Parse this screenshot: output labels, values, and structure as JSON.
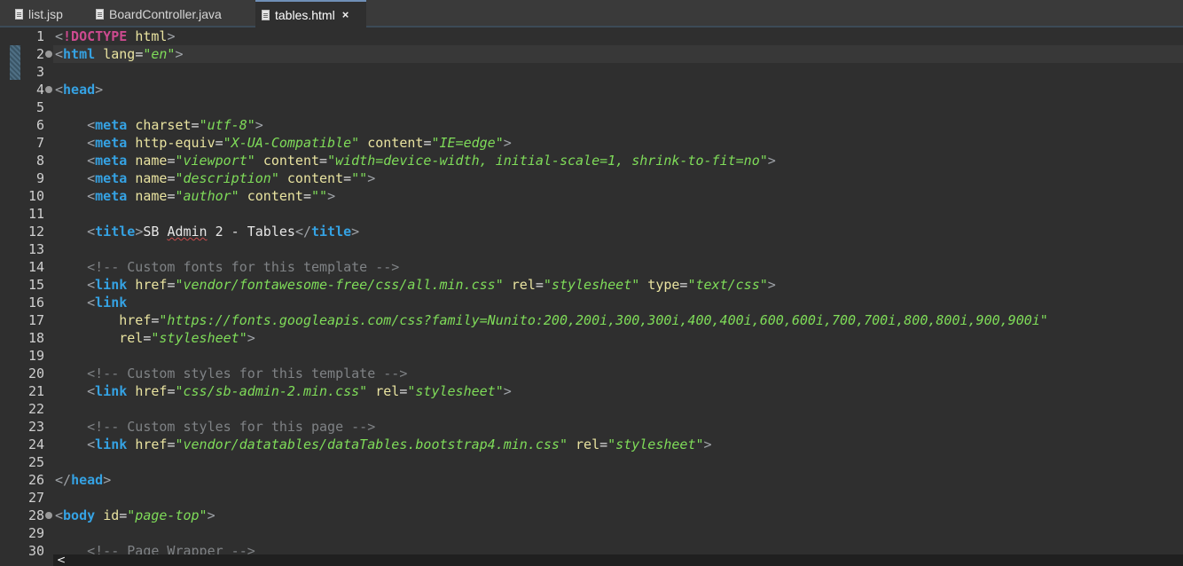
{
  "tabs": [
    {
      "label": "list.jsp",
      "icon": "file-icon",
      "active": false
    },
    {
      "label": "BoardController.java",
      "icon": "file-icon",
      "active": false
    },
    {
      "label": "tables.html",
      "icon": "file-icon",
      "active": true,
      "close": "×"
    }
  ],
  "colors": {
    "tag": "#35a2e3",
    "attribute": "#e9e3a0",
    "string": "#7fdc59",
    "comment": "#7f8285",
    "doctype": "#cc4a8f",
    "background": "#2f2f2f"
  },
  "editor": {
    "lines": [
      {
        "n": "1",
        "fold": false,
        "tokens": [
          [
            "bracket",
            "<"
          ],
          [
            "doctype",
            "!DOCTYPE "
          ],
          [
            "attr",
            "html"
          ],
          [
            "bracket",
            ">"
          ]
        ]
      },
      {
        "n": "2",
        "fold": true,
        "current": true,
        "tokens": [
          [
            "bracket",
            "<"
          ],
          [
            "tag",
            "html"
          ],
          [
            "plain",
            " "
          ],
          [
            "attr",
            "lang"
          ],
          [
            "plain",
            "="
          ],
          [
            "str",
            "\"en\""
          ],
          [
            "bracket",
            ">"
          ]
        ]
      },
      {
        "n": "3",
        "fold": false,
        "tokens": []
      },
      {
        "n": "4",
        "fold": true,
        "tokens": [
          [
            "bracket",
            "<"
          ],
          [
            "tag",
            "head"
          ],
          [
            "bracket",
            ">"
          ]
        ]
      },
      {
        "n": "5",
        "fold": false,
        "tokens": []
      },
      {
        "n": "6",
        "fold": false,
        "tokens": [
          [
            "plain",
            "    "
          ],
          [
            "bracket",
            "<"
          ],
          [
            "tag",
            "meta"
          ],
          [
            "plain",
            " "
          ],
          [
            "attr",
            "charset"
          ],
          [
            "plain",
            "="
          ],
          [
            "str",
            "\"utf-8\""
          ],
          [
            "bracket",
            ">"
          ]
        ]
      },
      {
        "n": "7",
        "fold": false,
        "tokens": [
          [
            "plain",
            "    "
          ],
          [
            "bracket",
            "<"
          ],
          [
            "tag",
            "meta"
          ],
          [
            "plain",
            " "
          ],
          [
            "attr",
            "http-equiv"
          ],
          [
            "plain",
            "="
          ],
          [
            "str",
            "\"X-UA-Compatible\""
          ],
          [
            "plain",
            " "
          ],
          [
            "attr",
            "content"
          ],
          [
            "plain",
            "="
          ],
          [
            "str",
            "\"IE=edge\""
          ],
          [
            "bracket",
            ">"
          ]
        ]
      },
      {
        "n": "8",
        "fold": false,
        "tokens": [
          [
            "plain",
            "    "
          ],
          [
            "bracket",
            "<"
          ],
          [
            "tag",
            "meta"
          ],
          [
            "plain",
            " "
          ],
          [
            "attr",
            "name"
          ],
          [
            "plain",
            "="
          ],
          [
            "str",
            "\"viewport\""
          ],
          [
            "plain",
            " "
          ],
          [
            "attr",
            "content"
          ],
          [
            "plain",
            "="
          ],
          [
            "str",
            "\"width=device-width, initial-scale=1, shrink-to-fit=no\""
          ],
          [
            "bracket",
            ">"
          ]
        ]
      },
      {
        "n": "9",
        "fold": false,
        "tokens": [
          [
            "plain",
            "    "
          ],
          [
            "bracket",
            "<"
          ],
          [
            "tag",
            "meta"
          ],
          [
            "plain",
            " "
          ],
          [
            "attr",
            "name"
          ],
          [
            "plain",
            "="
          ],
          [
            "str",
            "\"description\""
          ],
          [
            "plain",
            " "
          ],
          [
            "attr",
            "content"
          ],
          [
            "plain",
            "="
          ],
          [
            "str",
            "\"\""
          ],
          [
            "bracket",
            ">"
          ]
        ]
      },
      {
        "n": "10",
        "fold": false,
        "tokens": [
          [
            "plain",
            "    "
          ],
          [
            "bracket",
            "<"
          ],
          [
            "tag",
            "meta"
          ],
          [
            "plain",
            " "
          ],
          [
            "attr",
            "name"
          ],
          [
            "plain",
            "="
          ],
          [
            "str",
            "\"author\""
          ],
          [
            "plain",
            " "
          ],
          [
            "attr",
            "content"
          ],
          [
            "plain",
            "="
          ],
          [
            "str",
            "\"\""
          ],
          [
            "bracket",
            ">"
          ]
        ]
      },
      {
        "n": "11",
        "fold": false,
        "tokens": []
      },
      {
        "n": "12",
        "fold": false,
        "tokens": [
          [
            "plain",
            "    "
          ],
          [
            "bracket",
            "<"
          ],
          [
            "tag",
            "title"
          ],
          [
            "bracket",
            ">"
          ],
          [
            "text",
            "SB "
          ],
          [
            "squiggle",
            "Admin"
          ],
          [
            "text",
            " 2 - Tables"
          ],
          [
            "bracket",
            "</"
          ],
          [
            "tag",
            "title"
          ],
          [
            "bracket",
            ">"
          ]
        ]
      },
      {
        "n": "13",
        "fold": false,
        "tokens": []
      },
      {
        "n": "14",
        "fold": false,
        "tokens": [
          [
            "plain",
            "    "
          ],
          [
            "comment",
            "<!-- Custom fonts for this template -->"
          ]
        ]
      },
      {
        "n": "15",
        "fold": false,
        "tokens": [
          [
            "plain",
            "    "
          ],
          [
            "bracket",
            "<"
          ],
          [
            "tag",
            "link"
          ],
          [
            "plain",
            " "
          ],
          [
            "attr",
            "href"
          ],
          [
            "plain",
            "="
          ],
          [
            "str",
            "\"vendor/fontawesome-free/css/all.min.css\""
          ],
          [
            "plain",
            " "
          ],
          [
            "attr",
            "rel"
          ],
          [
            "plain",
            "="
          ],
          [
            "str",
            "\"stylesheet\""
          ],
          [
            "plain",
            " "
          ],
          [
            "attr",
            "type"
          ],
          [
            "plain",
            "="
          ],
          [
            "str",
            "\"text/css\""
          ],
          [
            "bracket",
            ">"
          ]
        ]
      },
      {
        "n": "16",
        "fold": false,
        "tokens": [
          [
            "plain",
            "    "
          ],
          [
            "bracket",
            "<"
          ],
          [
            "tag",
            "link"
          ]
        ]
      },
      {
        "n": "17",
        "fold": false,
        "tokens": [
          [
            "plain",
            "        "
          ],
          [
            "attr",
            "href"
          ],
          [
            "plain",
            "="
          ],
          [
            "str",
            "\"https://fonts.googleapis.com/css?family=Nunito:200,200i,300,300i,400,400i,600,600i,700,700i,800,800i,900,900i\""
          ]
        ]
      },
      {
        "n": "18",
        "fold": false,
        "tokens": [
          [
            "plain",
            "        "
          ],
          [
            "attr",
            "rel"
          ],
          [
            "plain",
            "="
          ],
          [
            "str",
            "\"stylesheet\""
          ],
          [
            "bracket",
            ">"
          ]
        ]
      },
      {
        "n": "19",
        "fold": false,
        "tokens": []
      },
      {
        "n": "20",
        "fold": false,
        "tokens": [
          [
            "plain",
            "    "
          ],
          [
            "comment",
            "<!-- Custom styles for this template -->"
          ]
        ]
      },
      {
        "n": "21",
        "fold": false,
        "tokens": [
          [
            "plain",
            "    "
          ],
          [
            "bracket",
            "<"
          ],
          [
            "tag",
            "link"
          ],
          [
            "plain",
            " "
          ],
          [
            "attr",
            "href"
          ],
          [
            "plain",
            "="
          ],
          [
            "str",
            "\"css/sb-admin-2.min.css\""
          ],
          [
            "plain",
            " "
          ],
          [
            "attr",
            "rel"
          ],
          [
            "plain",
            "="
          ],
          [
            "str",
            "\"stylesheet\""
          ],
          [
            "bracket",
            ">"
          ]
        ]
      },
      {
        "n": "22",
        "fold": false,
        "tokens": []
      },
      {
        "n": "23",
        "fold": false,
        "tokens": [
          [
            "plain",
            "    "
          ],
          [
            "comment",
            "<!-- Custom styles for this page -->"
          ]
        ]
      },
      {
        "n": "24",
        "fold": false,
        "tokens": [
          [
            "plain",
            "    "
          ],
          [
            "bracket",
            "<"
          ],
          [
            "tag",
            "link"
          ],
          [
            "plain",
            " "
          ],
          [
            "attr",
            "href"
          ],
          [
            "plain",
            "="
          ],
          [
            "str",
            "\"vendor/datatables/dataTables.bootstrap4.min.css\""
          ],
          [
            "plain",
            " "
          ],
          [
            "attr",
            "rel"
          ],
          [
            "plain",
            "="
          ],
          [
            "str",
            "\"stylesheet\""
          ],
          [
            "bracket",
            ">"
          ]
        ]
      },
      {
        "n": "25",
        "fold": false,
        "tokens": []
      },
      {
        "n": "26",
        "fold": false,
        "tokens": [
          [
            "bracket",
            "</"
          ],
          [
            "tag",
            "head"
          ],
          [
            "bracket",
            ">"
          ]
        ]
      },
      {
        "n": "27",
        "fold": false,
        "tokens": []
      },
      {
        "n": "28",
        "fold": true,
        "tokens": [
          [
            "bracket",
            "<"
          ],
          [
            "tag",
            "body"
          ],
          [
            "plain",
            " "
          ],
          [
            "attr",
            "id"
          ],
          [
            "plain",
            "="
          ],
          [
            "str",
            "\"page-top\""
          ],
          [
            "bracket",
            ">"
          ]
        ]
      },
      {
        "n": "29",
        "fold": false,
        "tokens": []
      },
      {
        "n": "30",
        "fold": false,
        "tokens": [
          [
            "plain",
            "    "
          ],
          [
            "comment",
            "<!-- Page Wrapper -->"
          ]
        ]
      }
    ]
  },
  "scrollbar": {
    "left_arrow": "<"
  }
}
